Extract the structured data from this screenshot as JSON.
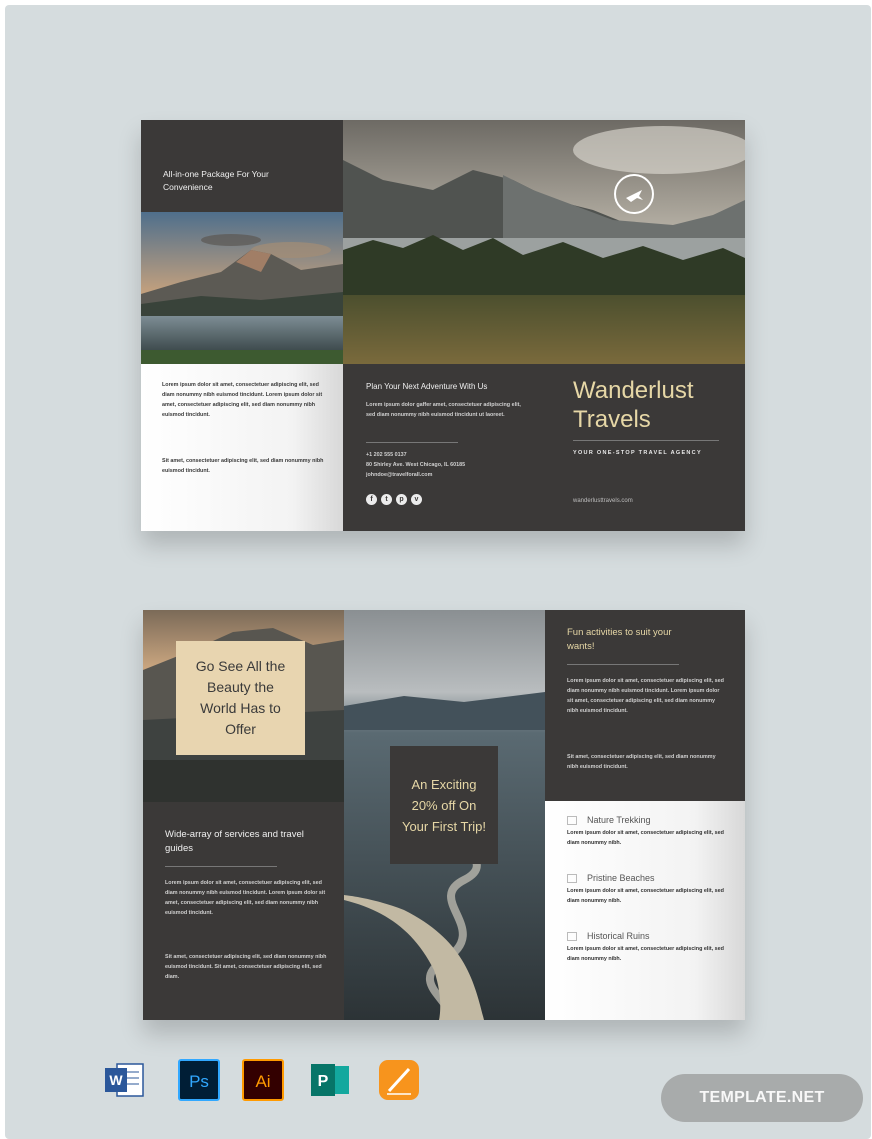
{
  "front": {
    "package_heading": "All-in-one Package For Your Convenience",
    "intro_text_1": "Lorem ipsum dolor sit amet, consectetuer adipiscing elit, sed diam nonummy nibh euismod tincidunt. Lorem ipsum dolor sit amet, consectetuer adipiscing elit, sed diam nonummy nibh euismod tincidunt.",
    "intro_text_2": "Sit amet, consectetuer adipiscing elit, sed diam nonummy nibh euismod tincidunt.",
    "plan_heading": "Plan Your Next Adventure With Us",
    "plan_text": "Lorem ipsum dolor gaffer amet, consectetuer adipiscing elit, sed diam nonummy nibh euismod tincidunt ut laoreet.",
    "phone": "+1 202 555 0137",
    "address": "80 Shirley Ave. West Chicago, IL 60185",
    "email": "johndoe@travelforall.com",
    "social_icons": [
      "facebook-icon",
      "twitter-icon",
      "pinterest-icon",
      "twitter-bird-icon"
    ],
    "brand_line_1": "Wanderlust",
    "brand_line_2": "Travels",
    "tagline": "YOUR ONE-STOP TRAVEL AGENCY",
    "website": "wanderlusttravels.com"
  },
  "back": {
    "beauty_box": "Go See All the Beauty the World Has to Offer",
    "services_heading": "Wide-array of services and travel guides",
    "services_text_1": "Lorem ipsum dolor sit amet, consectetuer adipiscing elit, sed diam nonummy nibh euismod tincidunt. Lorem ipsum dolor sit amet, consectetuer adipiscing elit, sed diam nonummy nibh euismod tincidunt.",
    "services_text_2": "Sit amet, consectetuer adipiscing elit, sed diam nonummy nibh euismod tincidunt. Sit amet, consectetuer adipiscing elit, sed diam.",
    "promo": "An Exciting 20% off On Your First Trip!",
    "fun_heading": "Fun activities to suit your wants!",
    "fun_text_1": "Lorem ipsum dolor sit amet, consectetuer adipiscing elit, sed diam nonummy nibh euismod tincidunt. Lorem ipsum dolor sit amet, consectetuer adipiscing elit, sed diam nonummy nibh euismod tincidunt.",
    "fun_text_2": "Sit amet, consectetuer adipiscing elit, sed diam nonummy nibh euismod tincidunt.",
    "activities": [
      {
        "title": "Nature Trekking",
        "desc": "Lorem ipsum dolor sit amet, consectetuer adipiscing elit, sed diam nonummy nibh."
      },
      {
        "title": "Pristine Beaches",
        "desc": "Lorem ipsum dolor sit amet, consectetuer adipiscing elit, sed diam nonummy nibh."
      },
      {
        "title": "Historical Ruins",
        "desc": "Lorem ipsum dolor sit amet, consectetuer adipiscing elit, sed diam nonummy nibh."
      }
    ]
  },
  "app_icons": [
    {
      "icon": "microsoft-word-icon",
      "label": "W",
      "color": "#2b579a"
    },
    {
      "icon": "photoshop-icon",
      "label": "Ps",
      "color": "#31a8ff"
    },
    {
      "icon": "illustrator-icon",
      "label": "Ai",
      "color": "#ff9a00"
    },
    {
      "icon": "publisher-icon",
      "label": "P",
      "color": "#077568"
    },
    {
      "icon": "pages-icon",
      "label": "",
      "color": "#f7941d"
    }
  ],
  "watermark": "TEMPLATE.NET",
  "colors": {
    "panel_dark": "#3b3938",
    "accent_gold": "#e6d7a6",
    "beauty_box": "#e8d5b0",
    "background": "#d5dcde"
  }
}
